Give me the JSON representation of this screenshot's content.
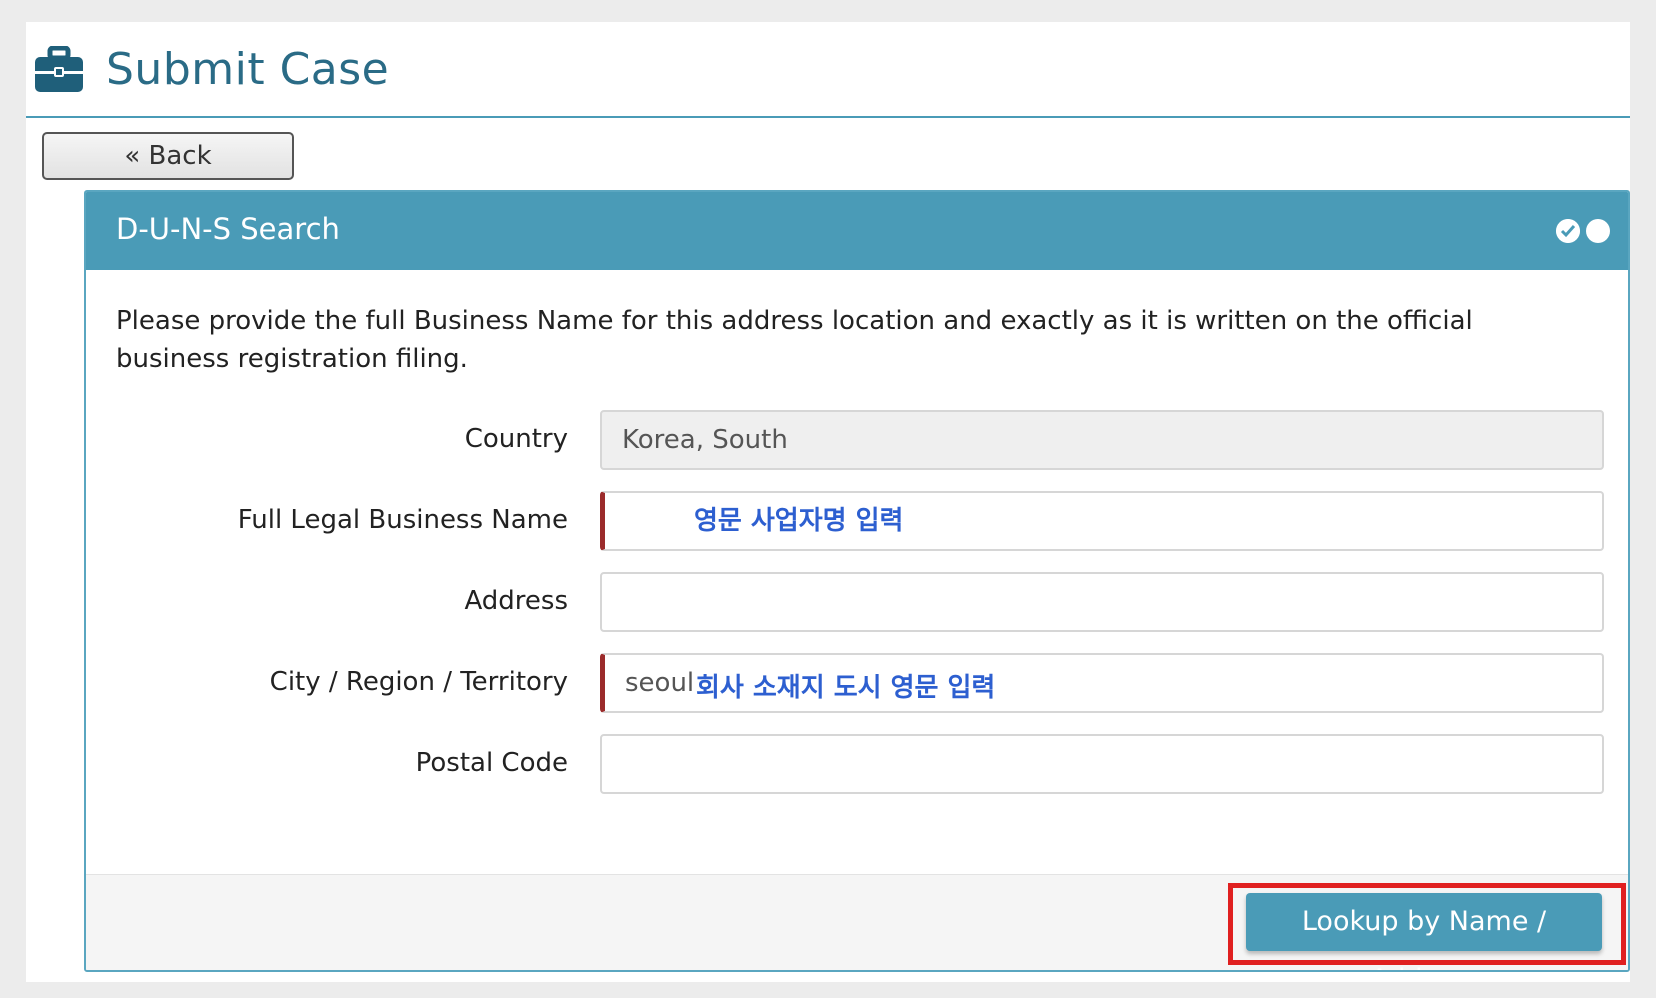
{
  "header": {
    "icon": "briefcase-icon",
    "title": "Submit Case"
  },
  "back_button": {
    "label": "« Back"
  },
  "panel": {
    "title": "D-U-N-S Search",
    "status_icons": [
      "check-dot-icon",
      "dot-icon"
    ],
    "intro": "Please provide the full Business Name for this address location and exactly as it is written on the official business registration filing.",
    "fields": [
      {
        "label": "Country",
        "value": "Korea, South",
        "readonly": true
      },
      {
        "label": "Full Legal Business Name",
        "value": "",
        "required": true,
        "note": "영문 사업자명 입력"
      },
      {
        "label": "Address",
        "value": ""
      },
      {
        "label": "City / Region / Territory",
        "value": "seoul",
        "required": true,
        "note": "회사 소재지 도시 영문 입력"
      },
      {
        "label": "Postal Code",
        "value": ""
      }
    ],
    "lookup_button": "Lookup by Name / Address"
  },
  "colors": {
    "accent": "#4a9bb7",
    "title": "#2a6b86",
    "required_marker": "#9b2b2b",
    "annotation": "#2d5fd0",
    "highlight": "#e02020"
  }
}
